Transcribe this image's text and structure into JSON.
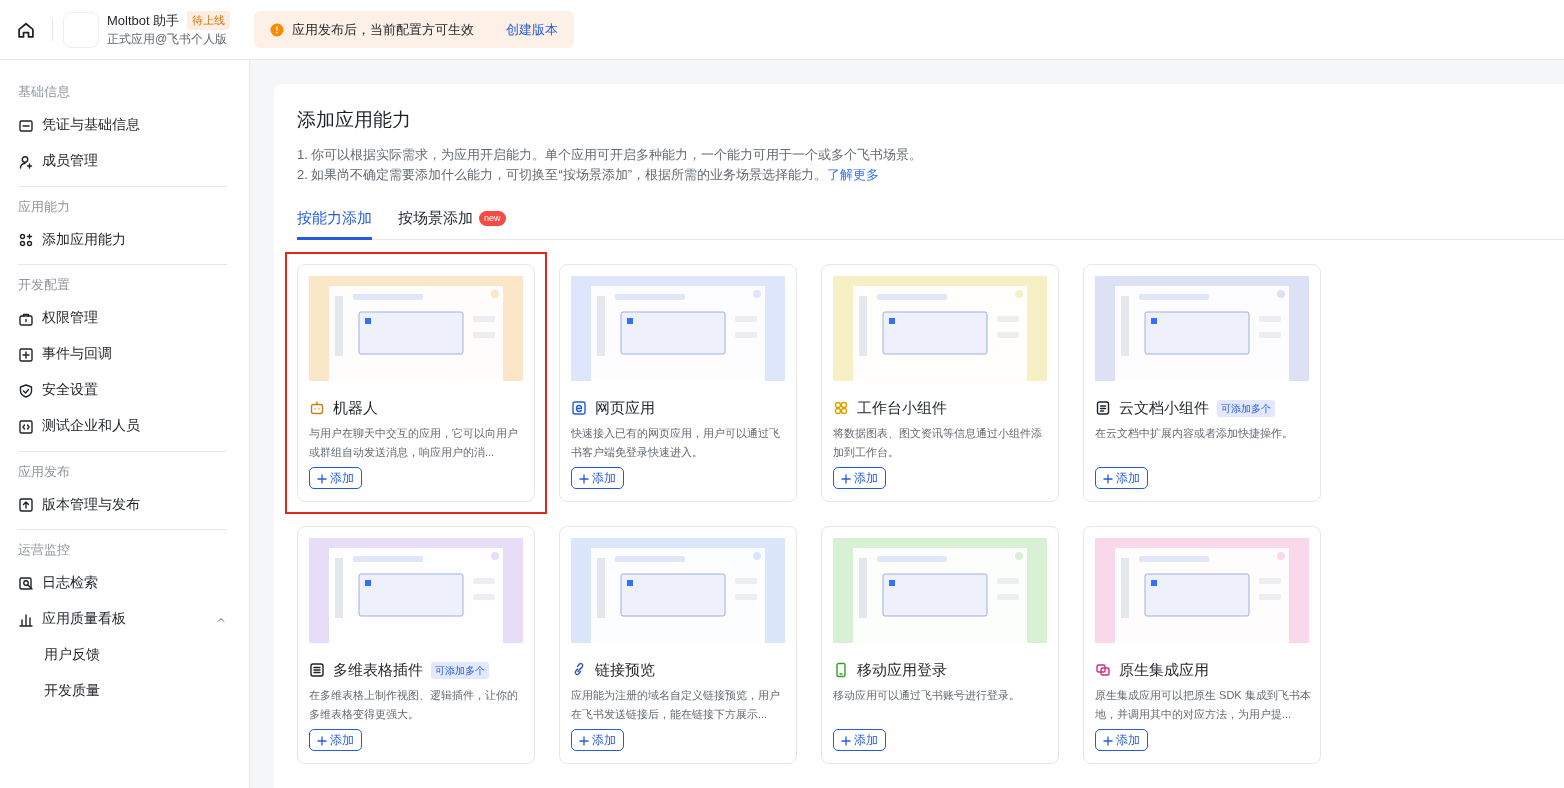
{
  "header": {
    "app_name": "Moltbot 助手",
    "status_badge": "待上线",
    "app_subtitle": "正式应用@飞书个人版",
    "notice": "应用发布后，当前配置方可生效",
    "notice_action": "创建版本"
  },
  "sidebar": {
    "groups": [
      {
        "heading": "基础信息",
        "items": [
          {
            "label": "凭证与基础信息"
          },
          {
            "label": "成员管理"
          }
        ]
      },
      {
        "heading": "应用能力",
        "items": [
          {
            "label": "添加应用能力"
          }
        ]
      },
      {
        "heading": "开发配置",
        "items": [
          {
            "label": "权限管理"
          },
          {
            "label": "事件与回调"
          },
          {
            "label": "安全设置"
          },
          {
            "label": "测试企业和人员"
          }
        ]
      },
      {
        "heading": "应用发布",
        "items": [
          {
            "label": "版本管理与发布"
          }
        ]
      },
      {
        "heading": "运营监控",
        "items": [
          {
            "label": "日志检索"
          },
          {
            "label": "应用质量看板",
            "expanded": true,
            "children": [
              {
                "label": "用户反馈"
              },
              {
                "label": "开发质量"
              }
            ]
          }
        ]
      }
    ]
  },
  "page": {
    "title": "添加应用能力",
    "notes": [
      "1. 你可以根据实际需求，为应用开启能力。单个应用可开启多种能力，一个能力可用于一个或多个飞书场景。",
      "2. 如果尚不确定需要添加什么能力，可切换至“按场景添加”，根据所需的业务场景选择能力。"
    ],
    "learn_more": "了解更多",
    "tabs": [
      {
        "label": "按能力添加",
        "selected": true
      },
      {
        "label": "按场景添加",
        "selected": false,
        "badge": "new"
      }
    ],
    "cards": [
      {
        "title": "机器人",
        "description": "与用户在聊天中交互的应用，它可以向用户或群组自动发送消息，响应用户的消...",
        "button": "添加",
        "highlighted": true
      },
      {
        "title": "网页应用",
        "description": "快速接入已有的网页应用，用户可以通过飞书客户端免登录快速进入。",
        "button": "添加",
        "highlighted": false
      },
      {
        "title": "工作台小组件",
        "description": "将数据图表、图文资讯等信息通过小组件添加到工作台。",
        "button": "添加",
        "highlighted": false
      },
      {
        "title": "云文档小组件",
        "tag": "可添加多个",
        "description": "在云文档中扩展内容或者添加快捷操作。",
        "button": "添加",
        "highlighted": false
      },
      {
        "title": "多维表格插件",
        "tag": "可添加多个",
        "description": "在多维表格上制作视图、逻辑插件，让你的多维表格变得更强大。",
        "button": "添加",
        "highlighted": false
      },
      {
        "title": "链接预览",
        "description": "应用能为注册的域名自定义链接预览，用户在飞书发送链接后，能在链接下方展示...",
        "button": "添加",
        "highlighted": false
      },
      {
        "title": "移动应用登录",
        "description": "移动应用可以通过飞书账号进行登录。",
        "button": "添加",
        "highlighted": false
      },
      {
        "title": "原生集成应用",
        "description": "原生集成应用可以把原生 SDK 集成到飞书本地，并调用其中的对应方法，为用户提...",
        "button": "添加",
        "highlighted": false
      }
    ]
  }
}
